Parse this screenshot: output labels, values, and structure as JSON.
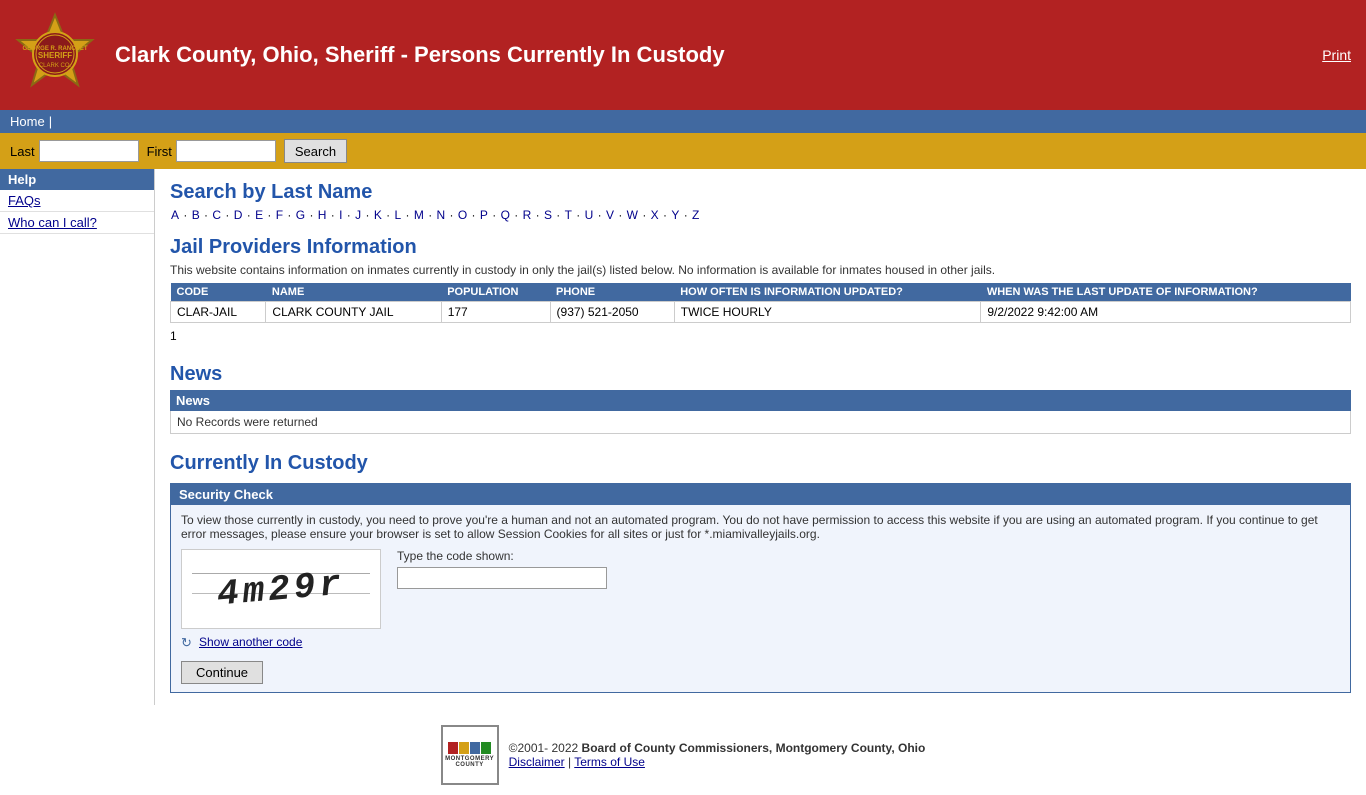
{
  "header": {
    "title": "Clark County, Ohio, Sheriff - Persons Currently In Custody",
    "print_label": "Print"
  },
  "navbar": {
    "home_label": "Home",
    "separator": "|"
  },
  "searchbar": {
    "last_label": "Last",
    "first_label": "First",
    "search_label": "Search",
    "last_placeholder": "",
    "first_placeholder": ""
  },
  "sidebar": {
    "help_label": "Help",
    "links": [
      {
        "id": "faqs",
        "label": "FAQs"
      },
      {
        "id": "who-can-i-call",
        "label": "Who can I call?"
      }
    ]
  },
  "search_section": {
    "title": "Search by Last Name",
    "alphabet": [
      "A",
      "B",
      "C",
      "D",
      "E",
      "F",
      "G",
      "H",
      "I",
      "J",
      "K",
      "L",
      "M",
      "N",
      "O",
      "P",
      "Q",
      "R",
      "S",
      "T",
      "U",
      "V",
      "W",
      "X",
      "Y",
      "Z"
    ]
  },
  "jail_providers": {
    "title": "Jail Providers Information",
    "description": "This website contains information on inmates currently in custody in only the jail(s) listed below. No information is available for inmates housed in other jails.",
    "columns": [
      "CODE",
      "NAME",
      "POPULATION",
      "PHONE",
      "HOW OFTEN IS INFORMATION UPDATED?",
      "WHEN WAS THE LAST UPDATE OF INFORMATION?"
    ],
    "rows": [
      {
        "code": "CLAR-JAIL",
        "name": "CLARK COUNTY JAIL",
        "population": "177",
        "phone": "(937) 521-2050",
        "update_frequency": "TWICE HOURLY",
        "last_update": "9/2/2022 9:42:00 AM"
      }
    ],
    "row_count": "1"
  },
  "news": {
    "title": "News",
    "header_label": "News",
    "no_records_message": "No Records were returned"
  },
  "custody": {
    "title": "Currently In Custody",
    "security_check_header": "Security Check",
    "security_desc": "To view those currently in custody, you need to prove you're a human and not an automated program. You do not have permission to access this website if you are using an automated program. If you continue to get error messages, please ensure your browser is set to allow Session Cookies for all sites or just for *.miamivalleyjails.org.",
    "captcha_text": "4m29r",
    "type_code_label": "Type the code shown:",
    "show_another_label": "Show another code",
    "continue_label": "Continue"
  },
  "footer": {
    "copyright": "©2001- 2022",
    "org_name": "Board of County Commissioners, Montgomery County, Ohio",
    "disclaimer_label": "Disclaimer",
    "terms_label": "Terms of Use",
    "separator": "|",
    "logo_lines": [
      "MONTGOMERY",
      "COUNTY"
    ]
  }
}
